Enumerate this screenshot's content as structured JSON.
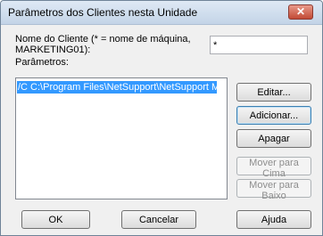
{
  "window": {
    "title": "Parâmetros dos Clientes nesta Unidade",
    "close_label": "✕"
  },
  "form": {
    "client_name_label_line1": "Nome do Cliente (* = nome de máquina,",
    "client_name_label_line2": "MARKETING01):",
    "client_name_value": "*",
    "params_label": "Parâmetros:"
  },
  "params_list": {
    "items": [
      "/C   C:\\Program Files\\NetSupport\\NetSupport Ma"
    ]
  },
  "buttons": {
    "edit": "Editar...",
    "add": "Adicionar...",
    "delete": "Apagar",
    "move_up": "Mover para Cima",
    "move_down": "Mover para Baixo",
    "ok": "OK",
    "cancel": "Cancelar",
    "help": "Ajuda"
  }
}
